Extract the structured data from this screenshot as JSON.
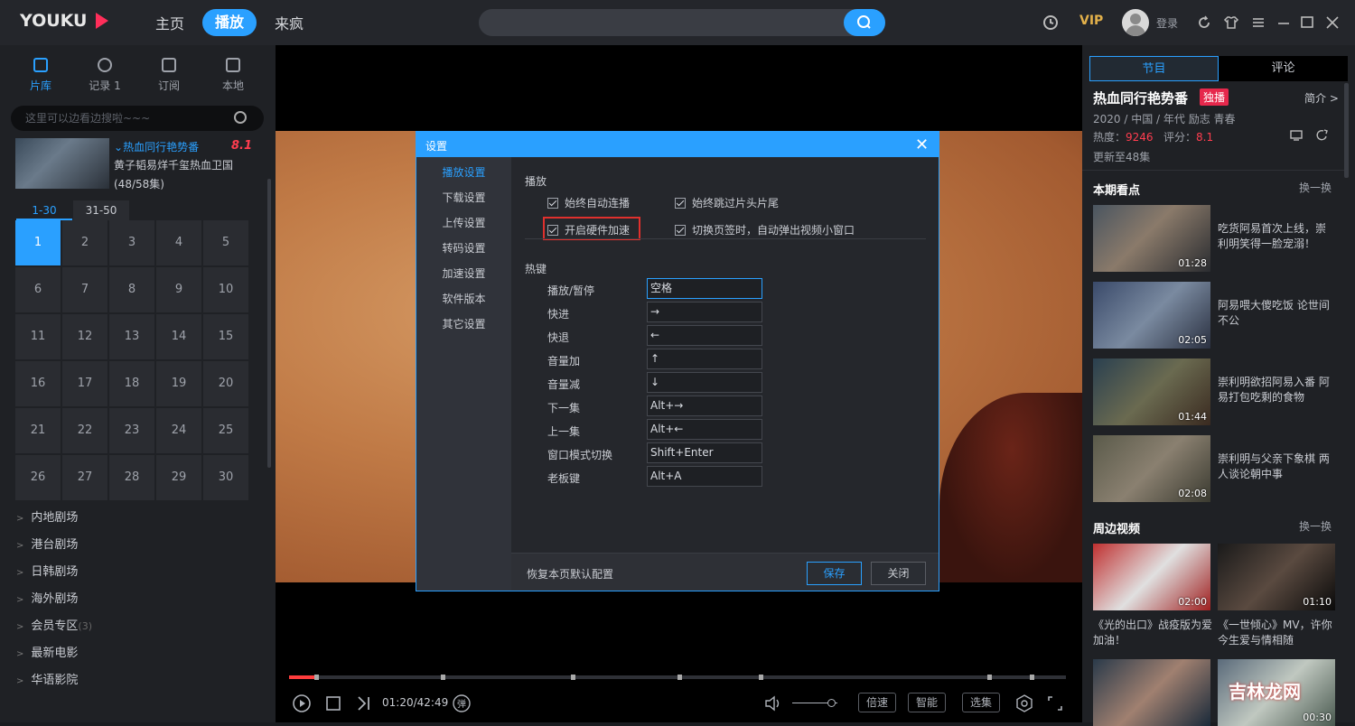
{
  "header": {
    "logo": "YOUKU",
    "nav": [
      "主页",
      "播放",
      "来疯"
    ],
    "vip": "VIP",
    "login": "登录"
  },
  "left": {
    "tabs": [
      "片库",
      "记录 1",
      "订阅",
      "本地"
    ],
    "search_placeholder": "这里可以边看边搜啦~~~",
    "series": {
      "title": "热血同行艳势番",
      "score": "8.1",
      "desc": "黄子韬易烊千玺热血卫国",
      "count": "(48/58集)"
    },
    "ep_tabs": [
      "1-30",
      "31-50"
    ],
    "episodes": [
      "1",
      "2",
      "3",
      "4",
      "5",
      "6",
      "7",
      "8",
      "9",
      "10",
      "11",
      "12",
      "13",
      "14",
      "15",
      "16",
      "17",
      "18",
      "19",
      "20",
      "21",
      "22",
      "23",
      "24",
      "25",
      "26",
      "27",
      "28",
      "29",
      "30"
    ],
    "categories": [
      {
        "label": "内地剧场",
        "count": ""
      },
      {
        "label": "港台剧场",
        "count": ""
      },
      {
        "label": "日韩剧场",
        "count": ""
      },
      {
        "label": "海外剧场",
        "count": ""
      },
      {
        "label": "会员专区",
        "count": "(3)"
      },
      {
        "label": "最新电影",
        "count": ""
      },
      {
        "label": "华语影院",
        "count": ""
      }
    ]
  },
  "player": {
    "time": "01:20/42:49",
    "progress": 0.035,
    "buttons": [
      "倍速",
      "智能",
      "选集"
    ],
    "danmaku": "弹"
  },
  "dialog": {
    "title": "设置",
    "menu": [
      "播放设置",
      "下载设置",
      "上传设置",
      "转码设置",
      "加速设置",
      "软件版本",
      "其它设置"
    ],
    "section_play": "播放",
    "checks": [
      "始终自动连播",
      "始终跳过片头片尾",
      "开启硬件加速",
      "切换页签时，自动弹出视频小窗口"
    ],
    "section_hotkeys": "热键",
    "hotkeys": [
      {
        "label": "播放/暂停",
        "value": "空格"
      },
      {
        "label": "快进",
        "value": "→"
      },
      {
        "label": "快退",
        "value": "←"
      },
      {
        "label": "音量加",
        "value": "↑"
      },
      {
        "label": "音量减",
        "value": "↓"
      },
      {
        "label": "下一集",
        "value": "Alt+→"
      },
      {
        "label": "上一集",
        "value": "Alt+←"
      },
      {
        "label": "窗口模式切换",
        "value": "Shift+Enter"
      },
      {
        "label": "老板键",
        "value": "Alt+A"
      }
    ],
    "reset": "恢复本页默认配置",
    "save": "保存",
    "close": "关闭"
  },
  "right": {
    "tabs": [
      "节目",
      "评论"
    ],
    "title": "热血同行艳势番",
    "badge": "独播",
    "intro": "简介 >",
    "meta": "2020 / 中国 / 年代 励志 青春",
    "heat_label": "热度：",
    "heat_value": "9246",
    "score_label": "评分：",
    "score_value": "8.1",
    "update": "更新至48集",
    "section1": "本期看点",
    "swap": "换一换",
    "highlights": [
      {
        "dur": "01:28",
        "desc": "吃货阿易首次上线，崇利明笑得一脸宠溺！"
      },
      {
        "dur": "02:05",
        "desc": "阿易喂大傻吃饭 论世间不公"
      },
      {
        "dur": "01:44",
        "desc": "崇利明欲招阿易入番 阿易打包吃剩的食物"
      },
      {
        "dur": "02:08",
        "desc": "崇利明与父亲下象棋 两人谈论朝中事"
      }
    ],
    "section2": "周边视频",
    "related": [
      {
        "dur": "02:00",
        "desc": "《光的出口》战疫版为爱加油！"
      },
      {
        "dur": "01:10",
        "desc": "《一世倾心》MV，许你今生爱与情相随"
      },
      {
        "dur": "",
        "desc": ""
      },
      {
        "dur": "00:30",
        "desc": ""
      }
    ]
  },
  "watermark": "吉林龙网"
}
